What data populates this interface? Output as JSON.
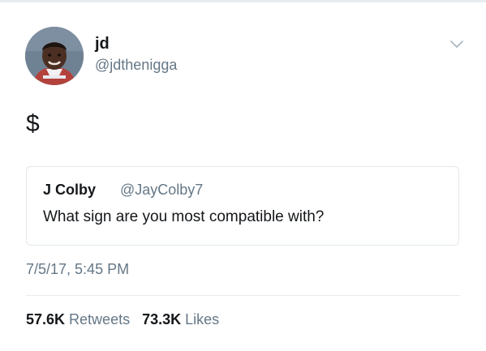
{
  "tweet": {
    "author": {
      "display_name": "jd",
      "handle": "@jdthenigga",
      "avatar_icon": "profile-photo"
    },
    "menu_icon": "chevron-down-icon",
    "text": "$",
    "quoted_tweet": {
      "author_name": "J Colby",
      "author_handle": "@JayColby7",
      "text": "What sign are you most compatible with?"
    },
    "timestamp": "7/5/17, 5:45 PM",
    "stats": {
      "retweets_count": "57.6K",
      "retweets_label": "Retweets",
      "likes_count": "73.3K",
      "likes_label": "Likes"
    }
  },
  "colors": {
    "primary_text": "#14171a",
    "secondary_text": "#657786",
    "border": "#e1e8ed",
    "divider": "#e6ecf0"
  }
}
